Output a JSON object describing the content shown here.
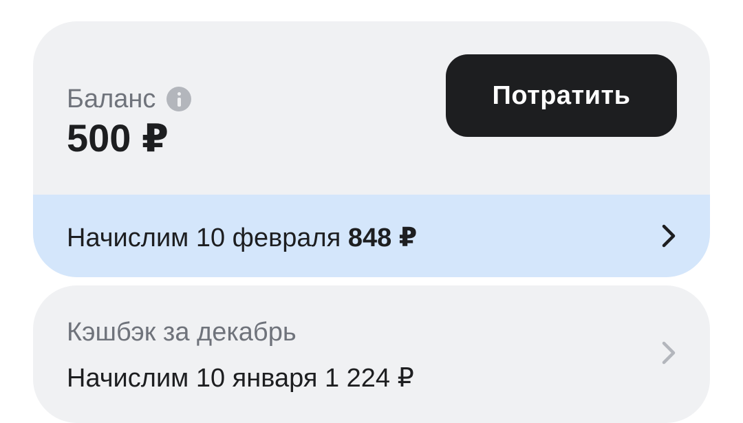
{
  "balance": {
    "label": "Баланс",
    "info_icon": "info-icon",
    "amount": "500 ₽",
    "spend_button_label": "Потратить"
  },
  "accrual": {
    "text": "Начислим 10 февраля",
    "amount": "848 ₽",
    "chevron_icon": "chevron-right-icon"
  },
  "cashback": {
    "label": "Кэшбэк за декабрь",
    "subtext": "Начислим 10 января 1 224 ₽",
    "chevron_icon": "chevron-right-icon"
  },
  "colors": {
    "card_background": "#f0f1f3",
    "accrual_background": "#d4e6fb",
    "button_background": "#1d1e20",
    "muted_text": "#6f737b",
    "primary_text": "#1d1e20"
  }
}
